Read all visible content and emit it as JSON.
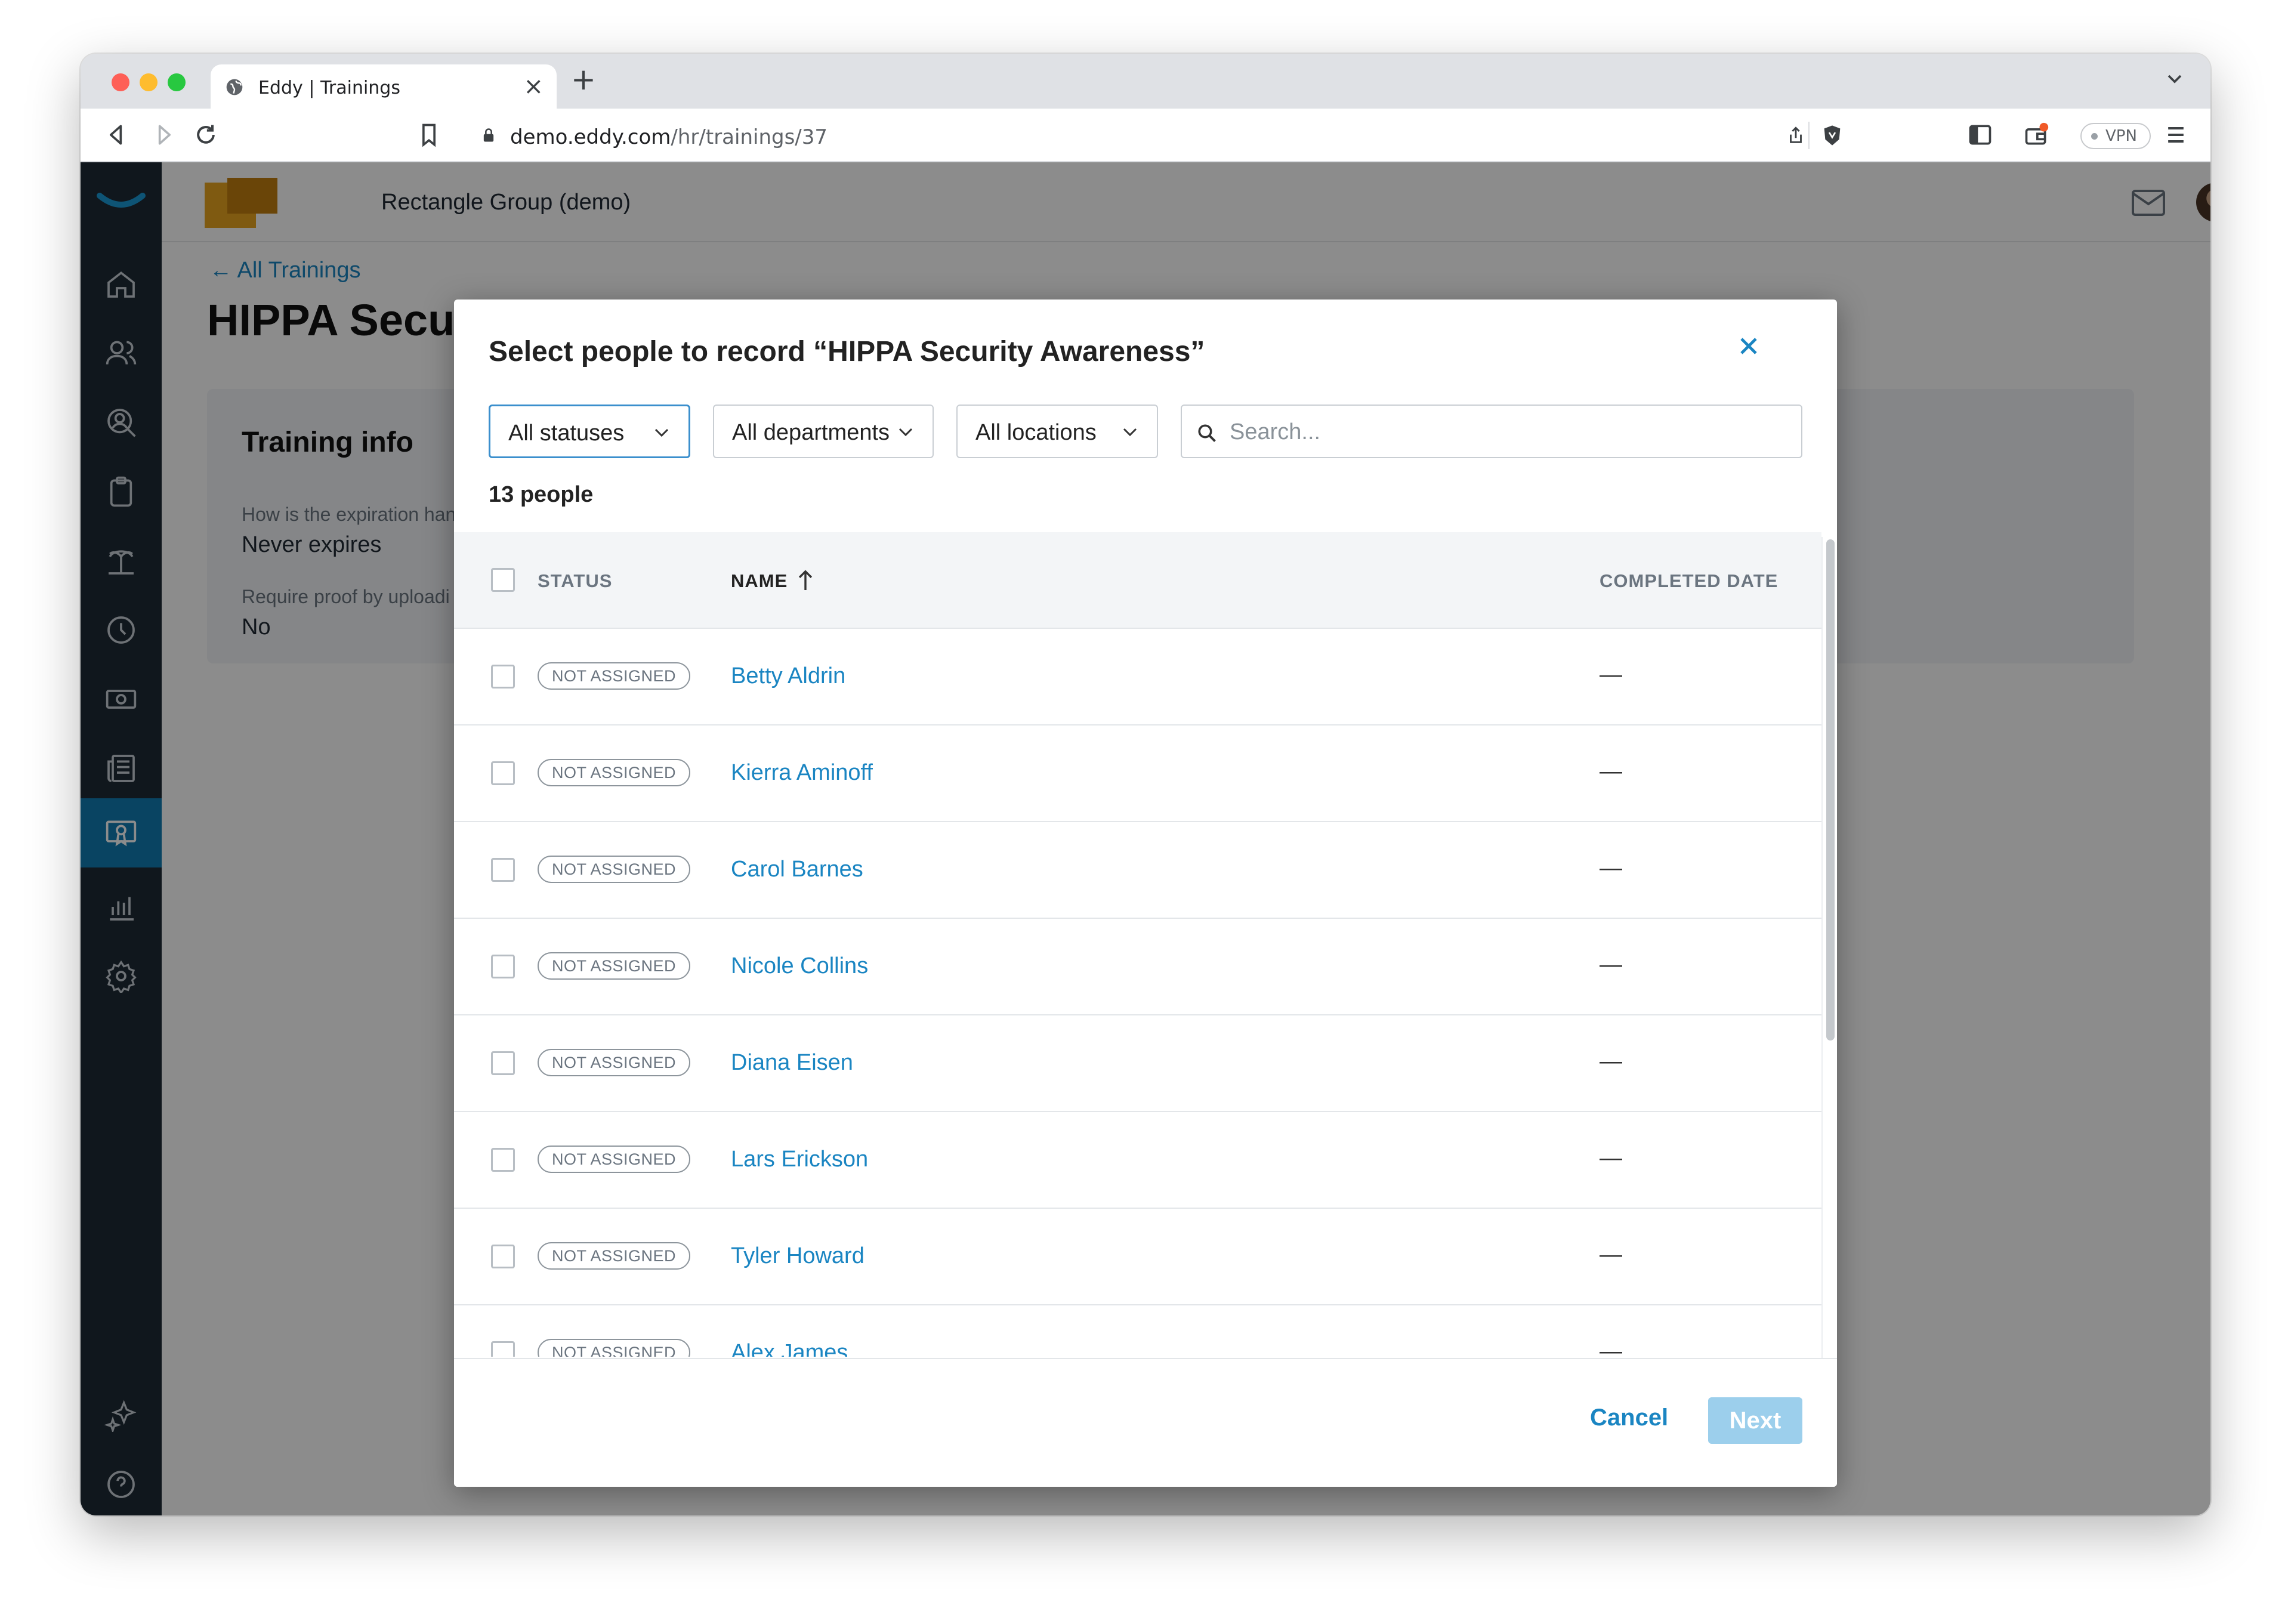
{
  "browser": {
    "tab_title": "Eddy | Trainings",
    "url_host": "demo.eddy.com",
    "url_path": "/hr/trainings/37",
    "vpn_label": "VPN"
  },
  "app": {
    "company_name": "Rectangle Group (demo)",
    "back_link": "All Trainings",
    "page_title": "HIPPA Securi",
    "card_title": "Training info",
    "field1_label": "How is the expiration han",
    "field1_value": "Never expires",
    "field2_label": "Require proof by uploadi",
    "field2_value": "No",
    "accent_color": "#1a85c2",
    "sidebar_icons": [
      "home-icon",
      "people-icon",
      "user-search-icon",
      "clipboard-icon",
      "beach-icon",
      "clock-icon",
      "money-icon",
      "newspaper-icon",
      "certificate-icon",
      "chart-icon",
      "gear-icon",
      "sparkle-icon",
      "help-icon"
    ],
    "active_sidebar_item": "certificate-icon"
  },
  "modal": {
    "title": "Select people to record “HIPPA Security Awareness”",
    "filters": {
      "status": "All statuses",
      "department": "All departments",
      "location": "All locations",
      "search_placeholder": "Search..."
    },
    "count_label": "13 people",
    "columns": {
      "status": "STATUS",
      "name": "NAME",
      "completed_date": "COMPLETED DATE"
    },
    "rows": [
      {
        "status": "NOT ASSIGNED",
        "name": "Betty Aldrin",
        "date": "—"
      },
      {
        "status": "NOT ASSIGNED",
        "name": "Kierra Aminoff",
        "date": "—"
      },
      {
        "status": "NOT ASSIGNED",
        "name": "Carol Barnes",
        "date": "—"
      },
      {
        "status": "NOT ASSIGNED",
        "name": "Nicole Collins",
        "date": "—"
      },
      {
        "status": "NOT ASSIGNED",
        "name": "Diana Eisen",
        "date": "—"
      },
      {
        "status": "NOT ASSIGNED",
        "name": "Lars Erickson",
        "date": "—"
      },
      {
        "status": "NOT ASSIGNED",
        "name": "Tyler Howard",
        "date": "—"
      },
      {
        "status": "NOT ASSIGNED",
        "name": "Alex James",
        "date": "—"
      }
    ],
    "cancel_label": "Cancel",
    "next_label": "Next"
  }
}
